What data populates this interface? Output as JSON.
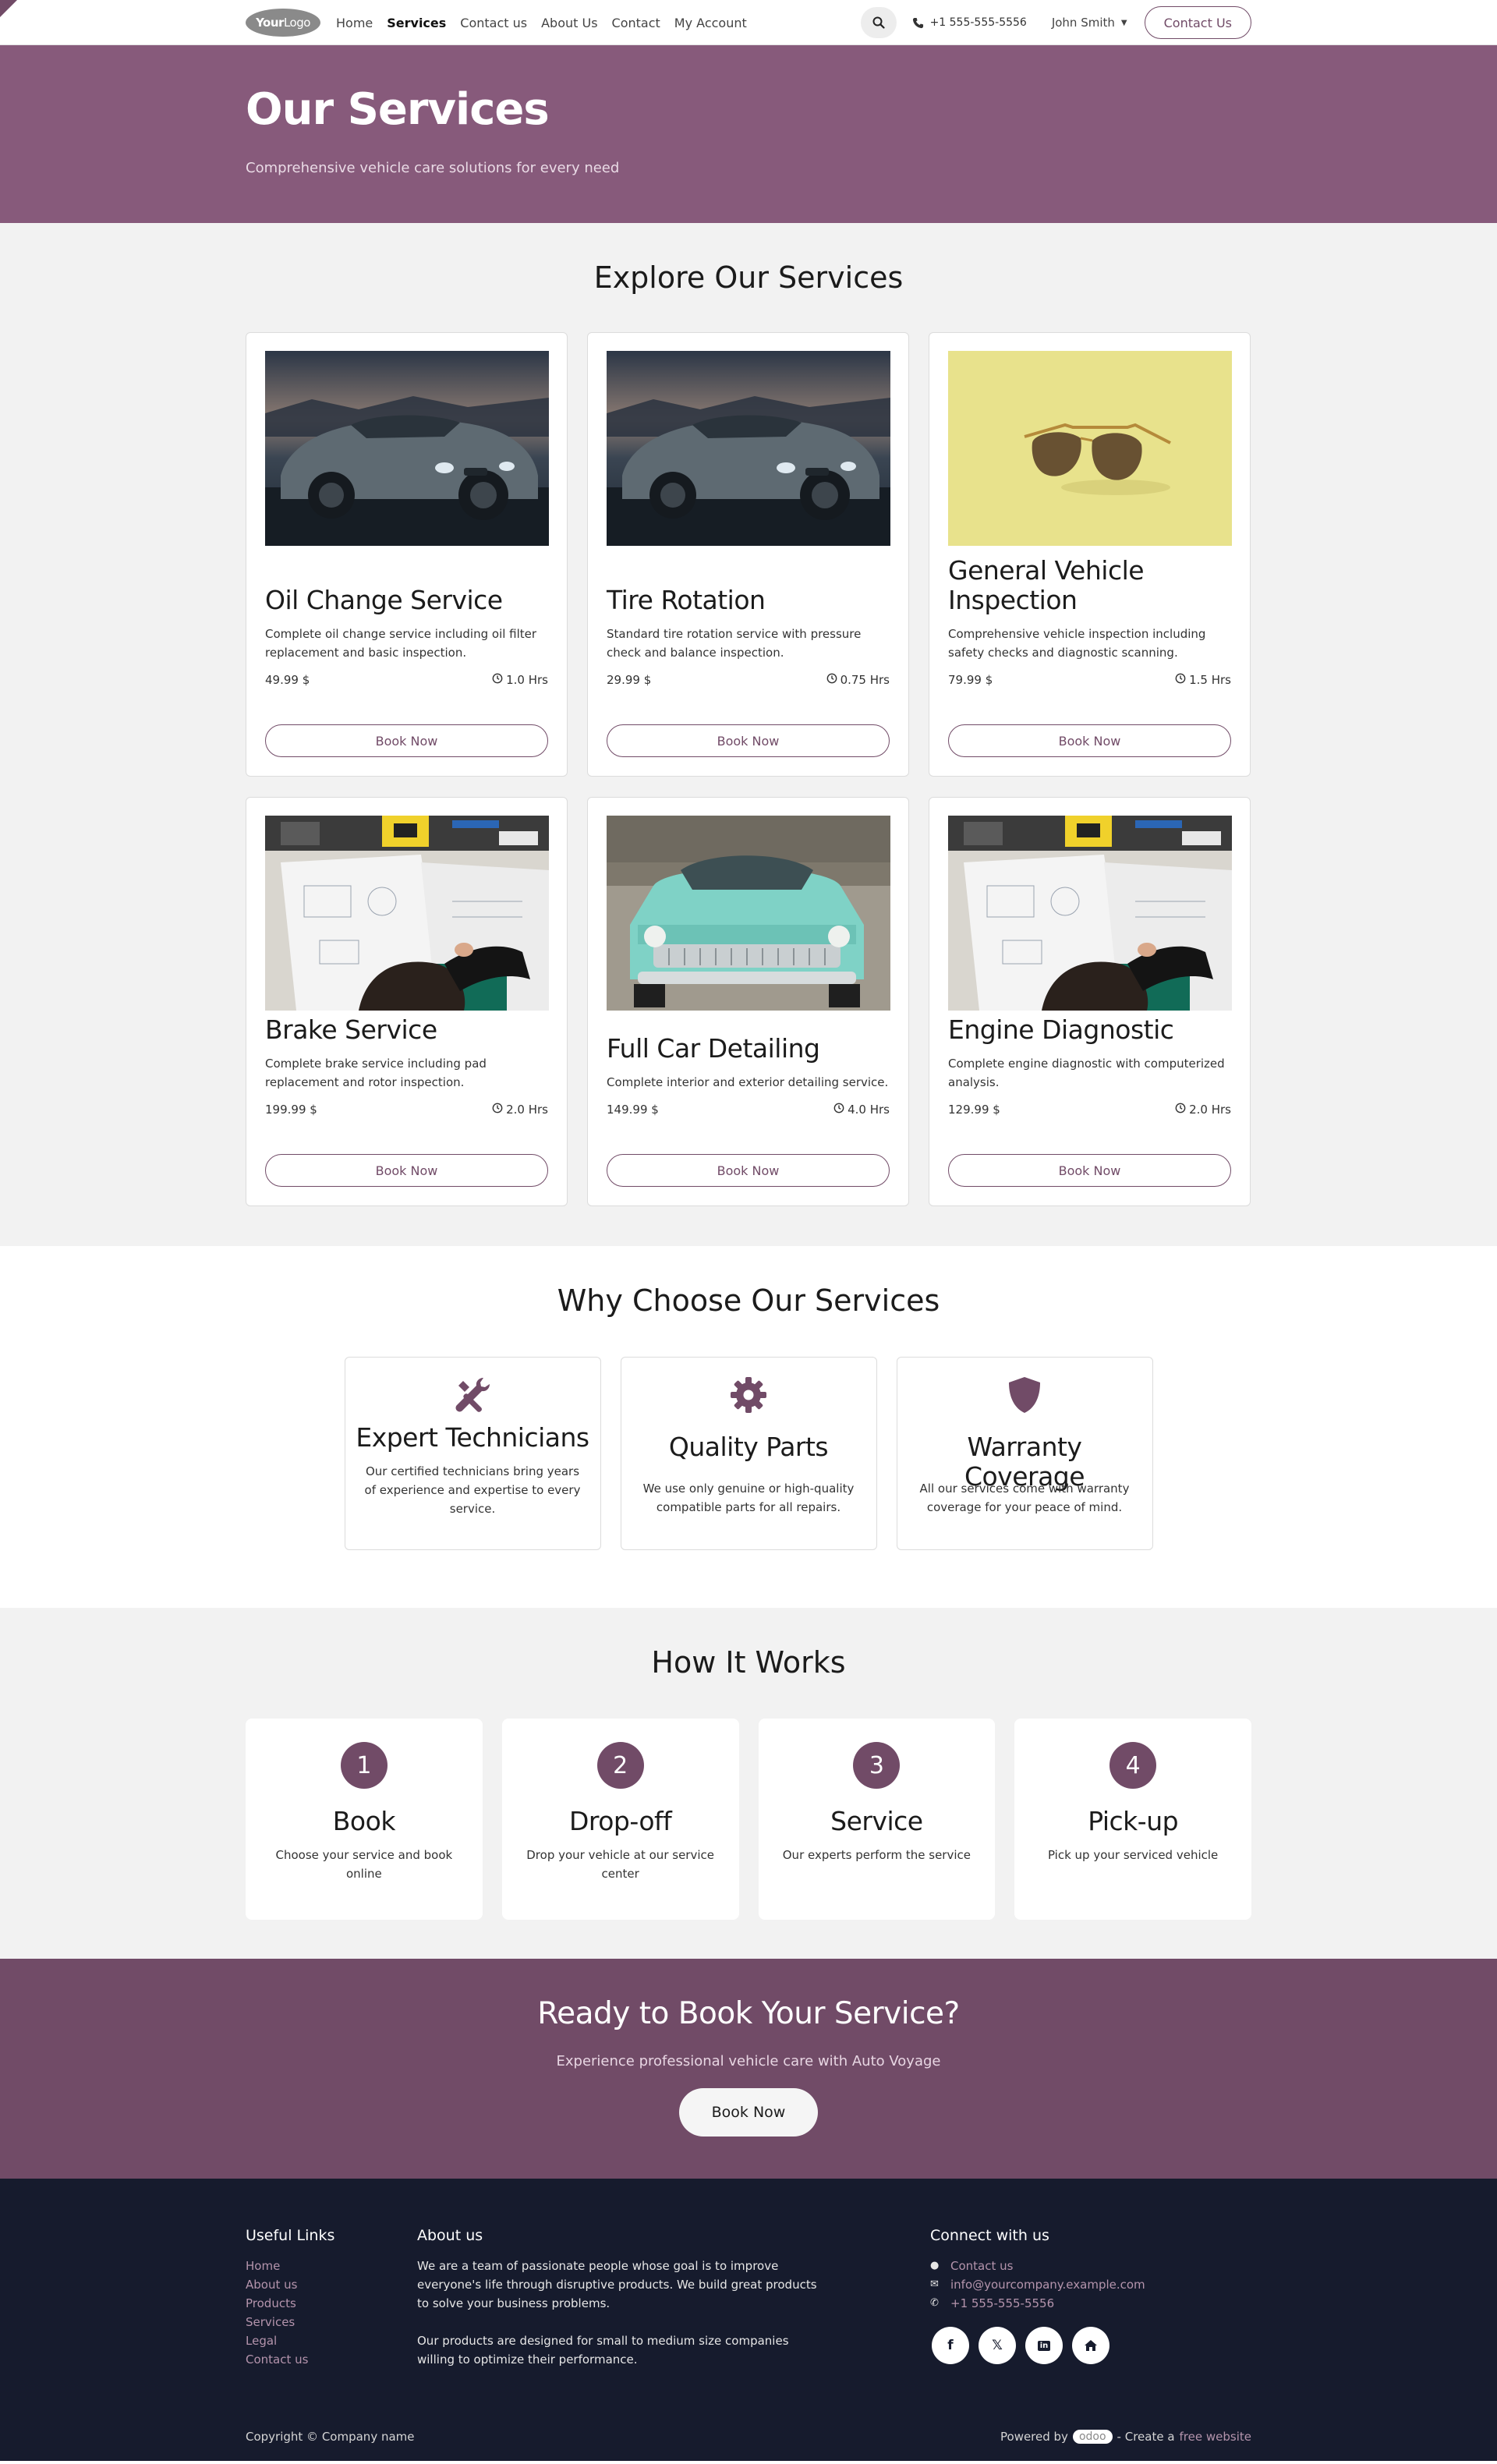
{
  "nav": {
    "logo_part1": "Your",
    "logo_part2": "Logo",
    "links": [
      "Home",
      "Services",
      "Contact us",
      "About Us",
      "Contact",
      "My Account"
    ],
    "phone": "+1 555-555-5556",
    "user": "John Smith",
    "contact_button": "Contact Us",
    "active_link": "Services"
  },
  "hero": {
    "title": "Our Services",
    "subtitle": "Comprehensive vehicle care solutions for every need"
  },
  "explore": {
    "title": "Explore Our Services",
    "services": [
      {
        "name": "Oil Change Service",
        "desc": "Complete oil change service including oil filter replacement and basic inspection.",
        "price": "49.99 $",
        "duration": "1.0 Hrs",
        "button": "Book Now",
        "image": "sports-car-photo"
      },
      {
        "name": "Tire Rotation",
        "desc": "Standard tire rotation service with pressure check and balance inspection.",
        "price": "29.99 $",
        "duration": "0.75 Hrs",
        "button": "Book Now",
        "image": "sports-car-photo"
      },
      {
        "name": "General Vehicle Inspection",
        "desc": "Comprehensive vehicle inspection including safety checks and diagnostic scanning.",
        "price": "79.99 $",
        "duration": "1.5 Hrs",
        "button": "Book Now",
        "image": "sunglasses-photo"
      },
      {
        "name": "Brake Service",
        "desc": "Complete brake service including pad replacement and rotor inspection.",
        "price": "199.99 $",
        "duration": "2.0 Hrs",
        "button": "Book Now",
        "image": "workbench-photo"
      },
      {
        "name": "Full Car Detailing",
        "desc": "Complete interior and exterior detailing service.",
        "price": "149.99 $",
        "duration": "4.0 Hrs",
        "button": "Book Now",
        "image": "classic-car-photo"
      },
      {
        "name": "Engine Diagnostic",
        "desc": "Complete engine diagnostic with computerized analysis.",
        "price": "129.99 $",
        "duration": "2.0 Hrs",
        "button": "Book Now",
        "image": "workbench-photo"
      }
    ]
  },
  "why": {
    "title": "Why Choose Our Services",
    "features": [
      {
        "title": "Expert Technicians",
        "desc": "Our certified technicians bring years of experience and expertise to every service.",
        "icon": "tools-icon"
      },
      {
        "title": "Quality Parts",
        "desc": "We use only genuine or high-quality compatible parts for all repairs.",
        "icon": "gear-icon"
      },
      {
        "title": "Warranty Coverage",
        "desc": "All our services come with warranty coverage for your peace of mind.",
        "icon": "shield-icon"
      }
    ]
  },
  "how": {
    "title": "How It Works",
    "steps": [
      {
        "num": "1",
        "title": "Book",
        "desc": "Choose your service and book online"
      },
      {
        "num": "2",
        "title": "Drop-off",
        "desc": "Drop your vehicle at our service center"
      },
      {
        "num": "3",
        "title": "Service",
        "desc": "Our experts perform the service"
      },
      {
        "num": "4",
        "title": "Pick-up",
        "desc": "Pick up your serviced vehicle"
      }
    ]
  },
  "cta": {
    "title": "Ready to Book Your Service?",
    "subtitle": "Experience professional vehicle care with Auto Voyage",
    "button": "Book Now"
  },
  "footer": {
    "useful_links_title": "Useful Links",
    "useful_links": [
      "Home",
      "About us",
      "Products",
      "Services",
      "Legal",
      "Contact us"
    ],
    "about_title": "About us",
    "about_p1": "We are a team of passionate people whose goal is to improve everyone's life through disruptive products. We build great products to solve your business problems.",
    "about_p2": "Our products are designed for small to medium size companies willing to optimize their performance.",
    "connect_title": "Connect with us",
    "contact_us": "Contact us",
    "email": "info@yourcompany.example.com",
    "phone": "+1 555-555-5556",
    "socials": [
      "facebook-icon",
      "x-icon",
      "linkedin-icon",
      "home-icon"
    ],
    "copyright": "Copyright © Company name",
    "powered_by": "Powered by",
    "odoo": "odoo",
    "create_a": "- Create a",
    "free_website": "free website"
  },
  "colors": {
    "brand": "#714b67",
    "hero_bg": "#875a7b",
    "footer_bg": "#161b2d",
    "section_grey": "#f2f2f2"
  }
}
